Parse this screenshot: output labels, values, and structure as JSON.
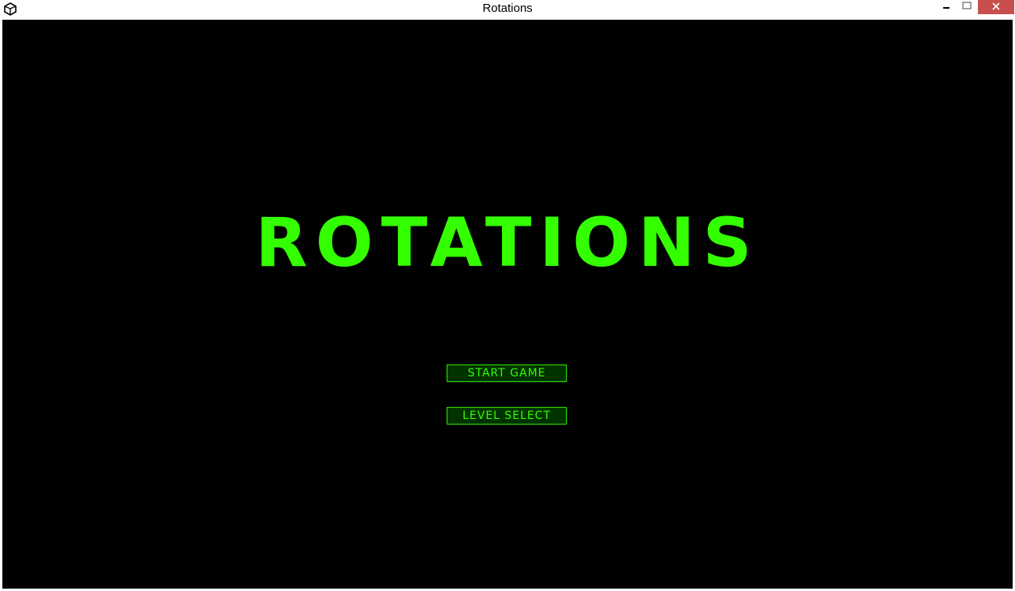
{
  "window": {
    "title": "Rotations",
    "icons": {
      "app": "unity-icon",
      "minimize": "minimize-icon",
      "maximize": "maximize-icon",
      "close": "close-icon"
    },
    "colors": {
      "close_button": "#c7504f"
    }
  },
  "game": {
    "title": "ROTATIONS",
    "menu": {
      "start_label": "START GAME",
      "level_select_label": "LEVEL SELECT"
    },
    "colors": {
      "background": "#000000",
      "accent": "#33ff00",
      "button_fill": "#003300"
    }
  }
}
